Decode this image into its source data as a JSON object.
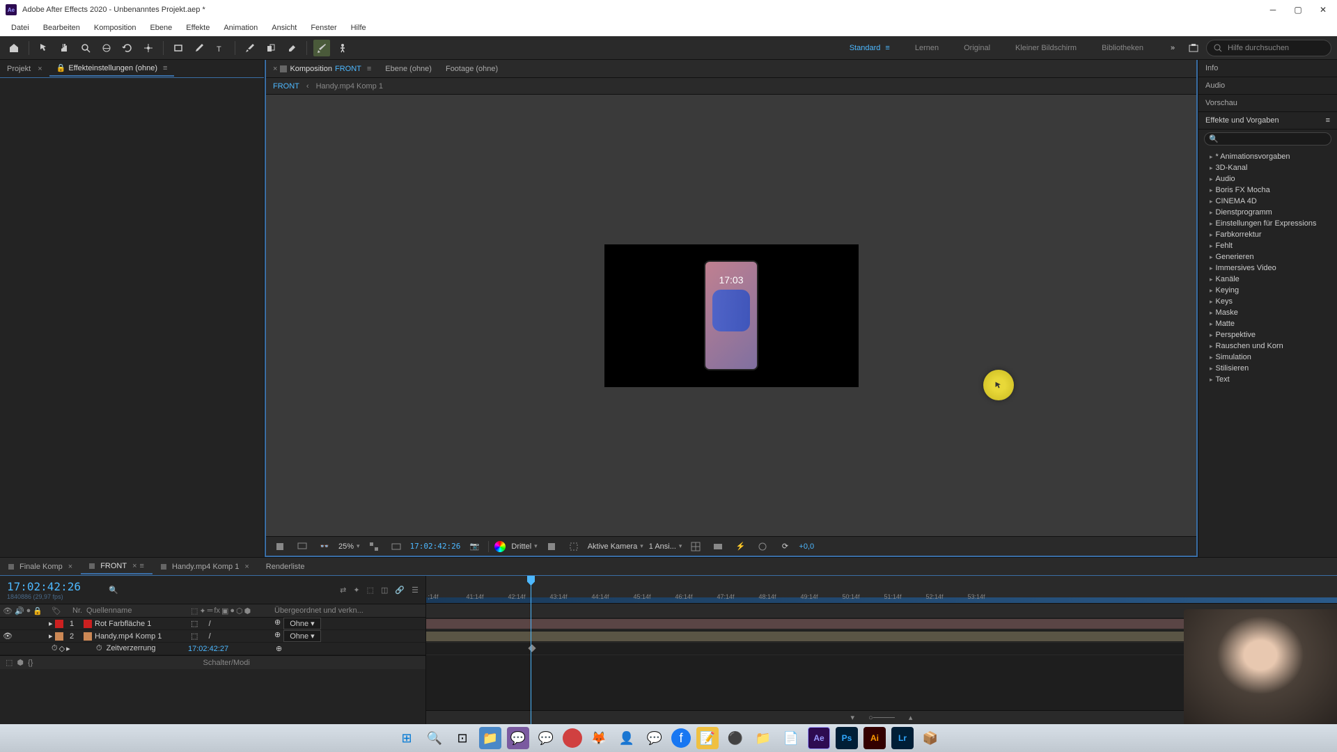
{
  "titlebar": {
    "app_name": "Ae",
    "title": "Adobe After Effects 2020 - Unbenanntes Projekt.aep *"
  },
  "menubar": [
    "Datei",
    "Bearbeiten",
    "Komposition",
    "Ebene",
    "Effekte",
    "Animation",
    "Ansicht",
    "Fenster",
    "Hilfe"
  ],
  "workspaces": {
    "active": "Standard",
    "items": [
      "Standard",
      "Lernen",
      "Original",
      "Kleiner Bildschirm",
      "Bibliotheken"
    ]
  },
  "search_placeholder": "Hilfe durchsuchen",
  "left_panel": {
    "project_tab": "Projekt",
    "effects_tab": "Effekteinstellungen (ohne)"
  },
  "composition": {
    "tab_prefix": "Komposition",
    "tab_name": "FRONT",
    "layer_tab": "Ebene (ohne)",
    "footage_tab": "Footage (ohne)",
    "breadcrumb": [
      "FRONT",
      "Handy.mp4 Komp 1"
    ],
    "phone_time": "17:03"
  },
  "viewport_footer": {
    "zoom": "25%",
    "timecode": "17:02:42:26",
    "quality": "Drittel",
    "camera": "Aktive Kamera",
    "views": "1 Ansi...",
    "exposure": "+0,0"
  },
  "right_panel": {
    "tabs": [
      "Info",
      "Audio",
      "Vorschau"
    ],
    "effects_title": "Effekte und Vorgaben",
    "effects_list": [
      "* Animationsvorgaben",
      "3D-Kanal",
      "Audio",
      "Boris FX Mocha",
      "CINEMA 4D",
      "Dienstprogramm",
      "Einstellungen für Expressions",
      "Farbkorrektur",
      "Fehlt",
      "Generieren",
      "Immersives Video",
      "Kanäle",
      "Keying",
      "Keys",
      "Maske",
      "Matte",
      "Perspektive",
      "Rauschen und Korn",
      "Simulation",
      "Stilisieren",
      "Text"
    ]
  },
  "timeline": {
    "tabs": [
      "Finale Komp",
      "FRONT",
      "Handy.mp4 Komp 1",
      "Renderliste"
    ],
    "active_tab": 1,
    "timecode": "17:02:42:26",
    "subtime": "1840886 (29,97 fps)",
    "header_source": "Quellenname",
    "header_parent": "Übergeordnet und verkn...",
    "parent_none": "Ohne",
    "layers": [
      {
        "num": "1",
        "color": "#cc2020",
        "name": "Rot Farbfläche 1",
        "parent": "Ohne"
      },
      {
        "num": "2",
        "color": "#cc8855",
        "name": "Handy.mp4 Komp 1",
        "parent": "Ohne"
      }
    ],
    "time_remap": "Zeitverzerrung",
    "time_remap_value": "17:02:42:27",
    "ruler_ticks": [
      ";14f",
      "41:14f",
      "42:14f",
      "43:14f",
      "44:14f",
      "45:14f",
      "46:14f",
      "47:14f",
      "48:14f",
      "49:14f",
      "50:14f",
      "51:14f",
      "52:14f",
      "53:14f"
    ],
    "footer_label": "Schalter/Modi"
  }
}
